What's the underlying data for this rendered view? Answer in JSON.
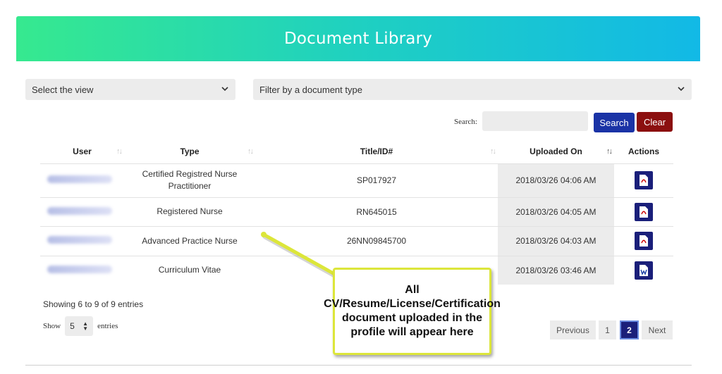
{
  "header": {
    "title": "Document Library"
  },
  "filters": {
    "view_select": "Select the view",
    "type_select": "Filter by a document type"
  },
  "search": {
    "label": "Search:",
    "button_label": "Search",
    "clear_label": "Clear"
  },
  "table": {
    "columns": [
      "User",
      "Type",
      "Title/ID#",
      "Uploaded On",
      "Actions"
    ],
    "rows": [
      {
        "type": "Certified Registred Nurse Practitioner",
        "title_id": "SP017927",
        "uploaded_on": "2018/03/26 04:06 AM",
        "action_icon": "pdf-icon"
      },
      {
        "type": "Registered Nurse",
        "title_id": "RN645015",
        "uploaded_on": "2018/03/26 04:05 AM",
        "action_icon": "pdf-icon"
      },
      {
        "type": "Advanced Practice Nurse",
        "title_id": "26NN09845700",
        "uploaded_on": "2018/03/26 04:03 AM",
        "action_icon": "pdf-icon"
      },
      {
        "type": "Curriculum Vitae",
        "title_id": "",
        "uploaded_on": "2018/03/26 03:46 AM",
        "action_icon": "word-icon"
      }
    ]
  },
  "footer": {
    "info": "Showing 6 to 9 of 9 entries",
    "show_label": "Show",
    "show_value": "5",
    "entries_label": "entries"
  },
  "pagination": {
    "previous": "Previous",
    "pages": [
      "1",
      "2"
    ],
    "current": "2",
    "next": "Next"
  },
  "callout": {
    "text": "All CV/Resume/License/Certification document uploaded in the profile will appear here"
  },
  "colors": {
    "header_gradient": [
      "#36e98f",
      "#12b9e6"
    ],
    "search_button": "#1a33a6",
    "clear_button": "#8b0f0f",
    "action_icon": "#1a1f7a",
    "callout_border": "#dce63a"
  }
}
